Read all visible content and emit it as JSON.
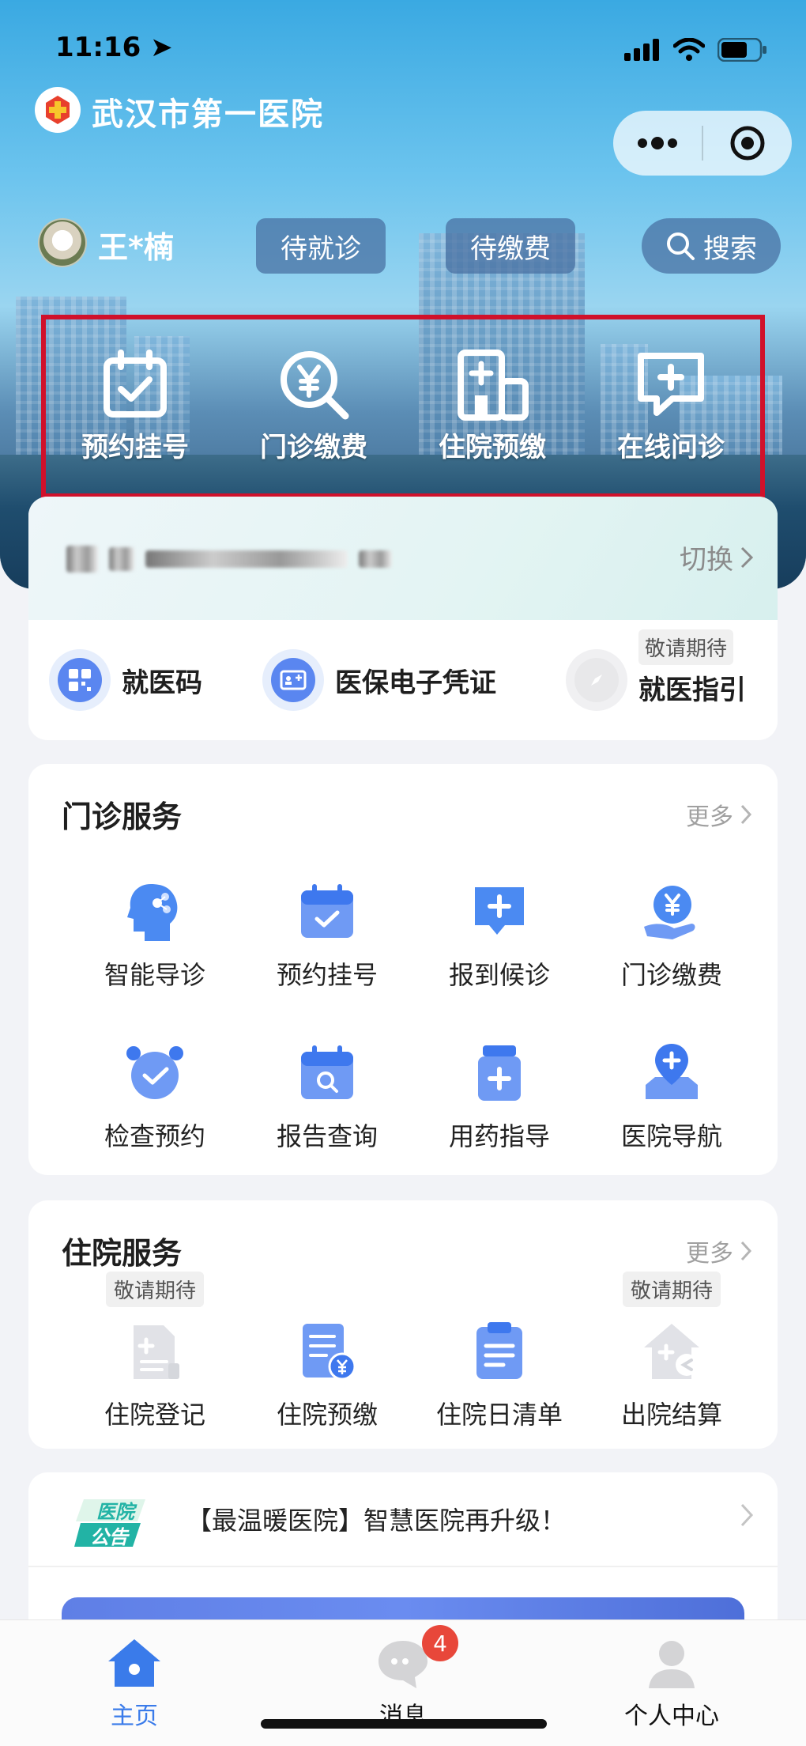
{
  "status_bar": {
    "time": "11:16"
  },
  "header": {
    "title": "武汉市第一医院"
  },
  "user": {
    "name": "王*楠",
    "pill_wait_visit": "待就诊",
    "pill_wait_pay": "待缴费",
    "search_label": "搜索"
  },
  "quick_actions": [
    {
      "label": "预约挂号",
      "icon": "calendar-check-icon"
    },
    {
      "label": "门诊缴费",
      "icon": "yuan-search-icon"
    },
    {
      "label": "住院预缴",
      "icon": "hospital-building-icon"
    },
    {
      "label": "在线问诊",
      "icon": "chat-plus-icon"
    }
  ],
  "patient_card": {
    "switch_label": "切换",
    "items": [
      {
        "label": "就医码",
        "icon": "qr-grid-icon"
      },
      {
        "label": "医保电子凭证",
        "icon": "id-card-icon"
      },
      {
        "label": "就医指引",
        "tag": "敬请期待",
        "icon": "compass-icon"
      }
    ]
  },
  "outpatient": {
    "title": "门诊服务",
    "more": "更多",
    "items": [
      {
        "label": "智能导诊",
        "icon": "head-ai-icon"
      },
      {
        "label": "预约挂号",
        "icon": "calendar-icon"
      },
      {
        "label": "报到候诊",
        "icon": "chat-plus-icon"
      },
      {
        "label": "门诊缴费",
        "icon": "hand-coin-icon"
      },
      {
        "label": "检查预约",
        "icon": "alarm-clock-icon"
      },
      {
        "label": "报告查询",
        "icon": "calendar-search-icon"
      },
      {
        "label": "用药指导",
        "icon": "medicine-bottle-icon"
      },
      {
        "label": "医院导航",
        "icon": "location-pin-icon"
      }
    ]
  },
  "inpatient": {
    "title": "住院服务",
    "more": "更多",
    "items": [
      {
        "label": "住院登记",
        "tag": "敬请期待",
        "icon": "register-doc-icon"
      },
      {
        "label": "住院预缴",
        "icon": "doc-yuan-icon"
      },
      {
        "label": "住院日清单",
        "icon": "clipboard-icon"
      },
      {
        "label": "出院结算",
        "tag": "敬请期待",
        "icon": "house-exit-icon"
      }
    ]
  },
  "notice": {
    "badge_line1": "医院",
    "badge_line2": "公告",
    "text": "【最温暖医院】智慧医院再升级！"
  },
  "tab_bar": {
    "tabs": [
      {
        "label": "主页",
        "icon": "home-icon",
        "active": true
      },
      {
        "label": "消息",
        "icon": "message-icon",
        "badge": "4"
      },
      {
        "label": "个人中心",
        "icon": "profile-icon"
      }
    ]
  },
  "colors": {
    "accent": "#3a7bea",
    "highlight_border": "#d0112b",
    "badge": "#e8473a"
  }
}
